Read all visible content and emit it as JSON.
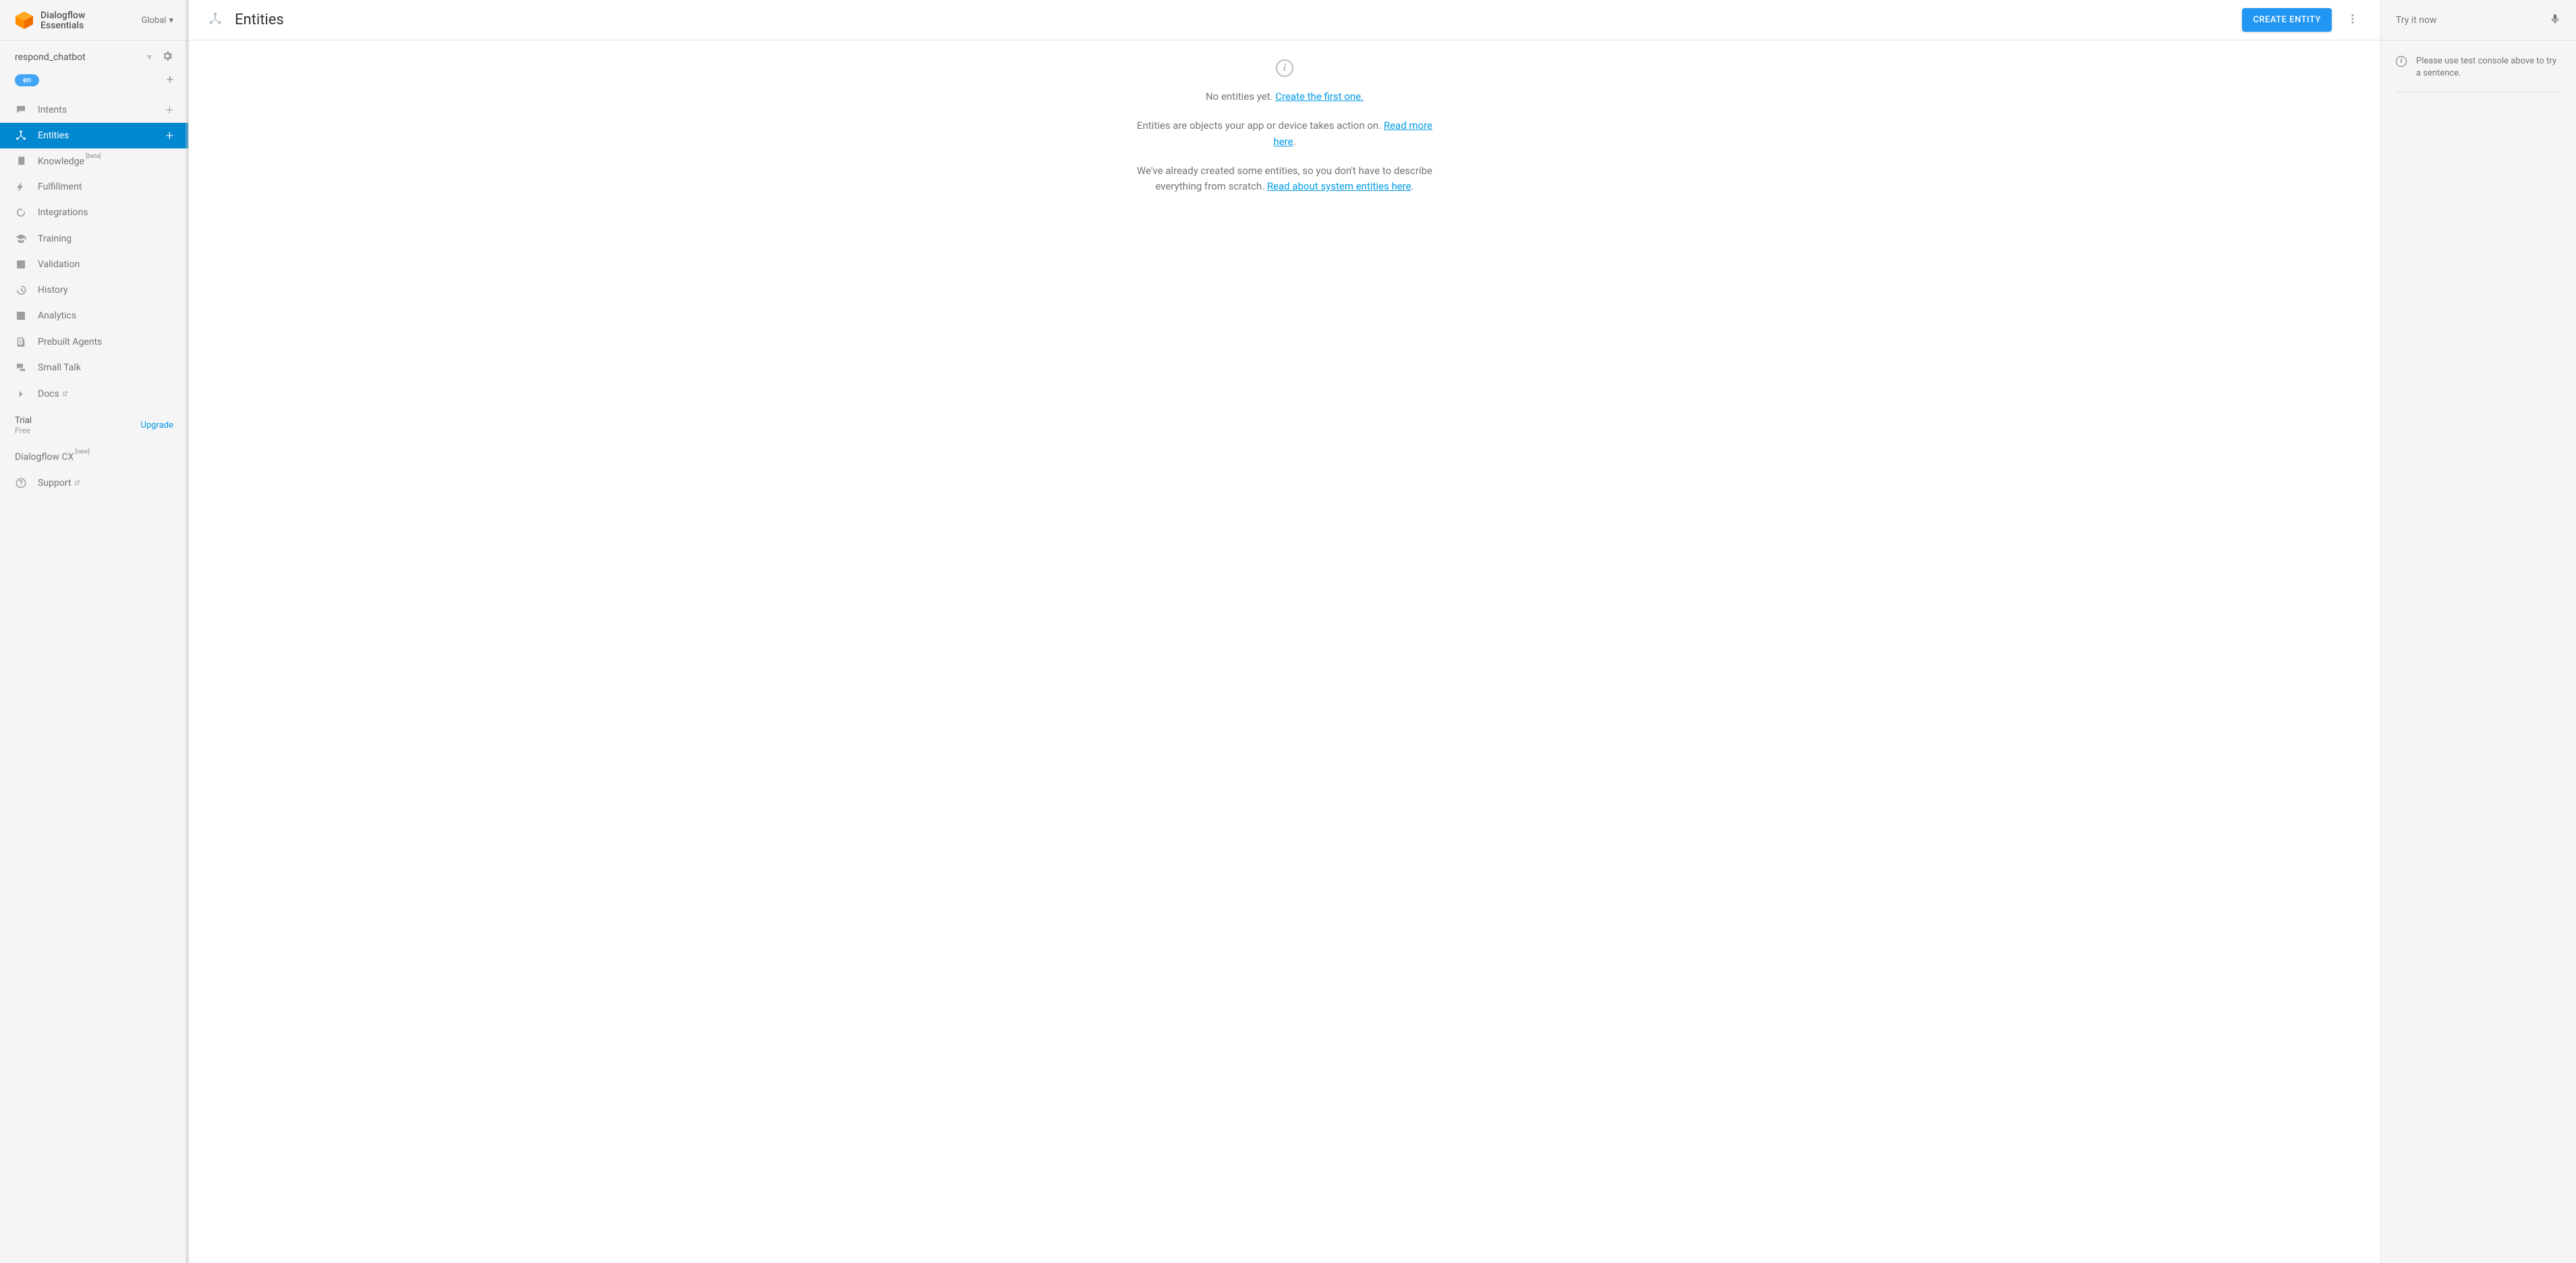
{
  "brand": {
    "line1": "Dialogflow",
    "line2": "Essentials",
    "region": "Global"
  },
  "agent": {
    "name": "respond_chatbot",
    "lang": "en"
  },
  "nav": {
    "intents": "Intents",
    "entities": "Entities",
    "knowledge": "Knowledge",
    "knowledge_badge": "[beta]",
    "fulfillment": "Fulfillment",
    "integrations": "Integrations",
    "training": "Training",
    "validation": "Validation",
    "history": "History",
    "analytics": "Analytics",
    "prebuilt": "Prebuilt Agents",
    "smalltalk": "Small Talk",
    "docs": "Docs",
    "cx": "Dialogflow CX",
    "cx_badge": "[new]",
    "support": "Support"
  },
  "plan": {
    "name": "Trial",
    "tier": "Free",
    "upgrade": "Upgrade"
  },
  "header": {
    "title": "Entities",
    "create_btn": "CREATE ENTITY"
  },
  "empty": {
    "line1_a": "No entities yet. ",
    "line1_link": "Create the first one.",
    "line2_a": "Entities are objects your app or device takes action on. ",
    "line2_link": "Read more here",
    "line2_b": ".",
    "line3_a": "We've already created some entities, so you don't have to describe everything from scratch. ",
    "line3_link": "Read about system entities here",
    "line3_b": "."
  },
  "right": {
    "try_placeholder": "Try it now",
    "hint": "Please use test console above to try a sentence."
  }
}
